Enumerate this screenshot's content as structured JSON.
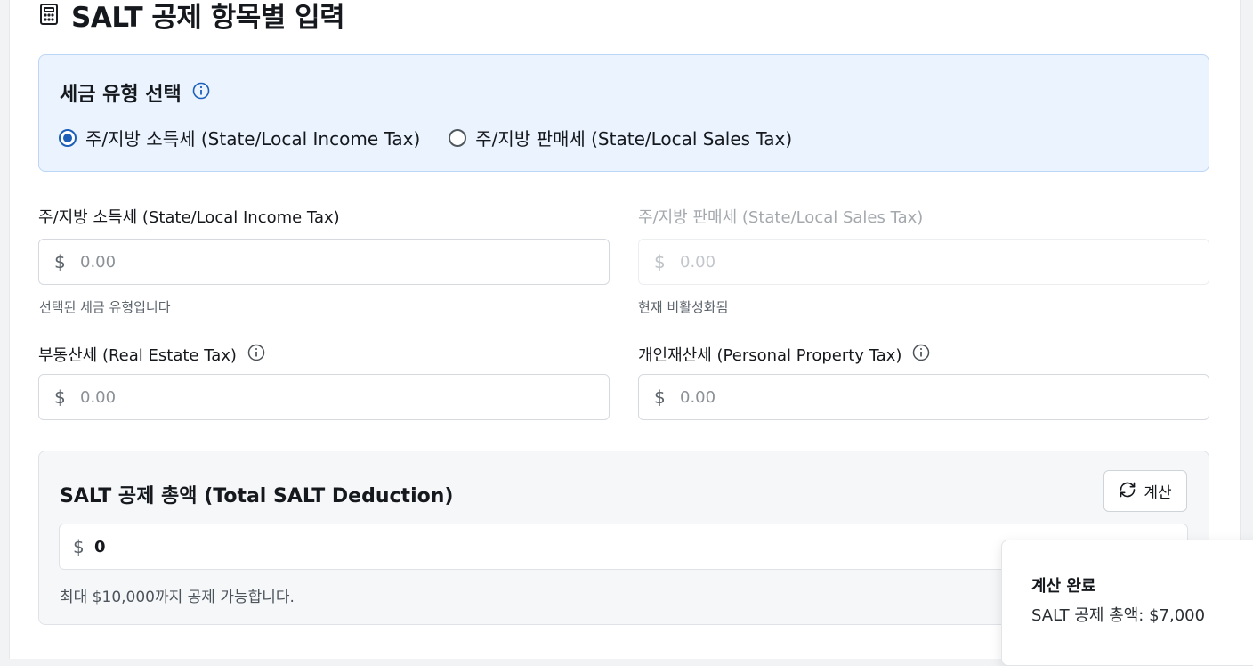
{
  "header": {
    "title": "SALT 공제 항목별 입력",
    "icon": "calculator-icon"
  },
  "tax_type": {
    "title": "세금 유형 선택",
    "info_icon": "info-icon",
    "options": [
      {
        "label": "주/지방 소득세 (State/Local Income Tax)",
        "selected": true
      },
      {
        "label": "주/지방 판매세 (State/Local Sales Tax)",
        "selected": false
      }
    ]
  },
  "fields": {
    "income": {
      "label": "주/지방 소득세 (State/Local Income Tax)",
      "currency": "$",
      "placeholder": "0.00",
      "help": "선택된 세금 유형입니다",
      "disabled": false
    },
    "sales": {
      "label": "주/지방 판매세 (State/Local Sales Tax)",
      "currency": "$",
      "placeholder": "0.00",
      "help": "현재 비활성화됨",
      "disabled": true
    },
    "real_estate": {
      "label": "부동산세 (Real Estate Tax)",
      "currency": "$",
      "placeholder": "0.00"
    },
    "personal_property": {
      "label": "개인재산세 (Personal Property Tax)",
      "currency": "$",
      "placeholder": "0.00"
    }
  },
  "total": {
    "title": "SALT 공제 총액 (Total SALT Deduction)",
    "calc_button": "계산",
    "currency": "$",
    "value": "0",
    "help": "최대 $10,000까지 공제 가능합니다."
  },
  "toast": {
    "title": "계산 완료",
    "message": "SALT 공제 총액: $7,000"
  },
  "colors": {
    "accent": "#1c5fb8",
    "info_panel_bg": "#eaf3fe",
    "info_panel_border": "#bcd6f5"
  }
}
